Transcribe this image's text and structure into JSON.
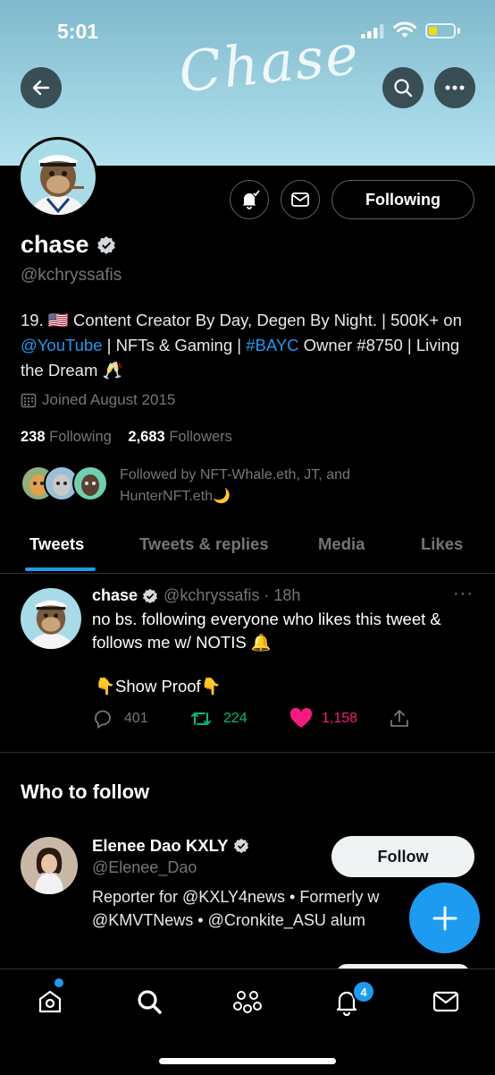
{
  "status": {
    "time": "5:01"
  },
  "banner": {
    "text": "Chase"
  },
  "profile": {
    "name": "chase",
    "handle": "@kchryssafis",
    "following_button": "Following",
    "bio": {
      "p1": "19. 🇺🇸 Content Creator By Day, Degen By Night. | 500K+ on ",
      "link1": "@YouTube",
      "p2": " | NFTs & Gaming | ",
      "link2": "#BAYC",
      "p3": " Owner #8750 | Living the Dream 🥂"
    },
    "joined": "Joined August 2015",
    "following_count": "238",
    "following_label": "Following",
    "followers_count": "2,683",
    "followers_label": "Followers",
    "followed_by": "Followed by NFT-Whale.eth, JT, and HunterNFT.eth🌙"
  },
  "tabs": [
    "Tweets",
    "Tweets & replies",
    "Media",
    "Likes"
  ],
  "tweet": {
    "name": "chase",
    "meta": "@kchryssafis · 18h",
    "text": "no bs. following everyone who likes this tweet & follows me w/ NOTIS 🔔",
    "link_card": "👇Show Proof👇",
    "replies": "401",
    "retweets": "224",
    "likes": "1,158",
    "colors": {
      "retweet": "#00ba7c",
      "like": "#f91880"
    }
  },
  "who_to_follow": {
    "title": "Who to follow",
    "items": [
      {
        "name": "Elenee Dao KXLY",
        "handle": "@Elenee_Dao",
        "bio_line1": "Reporter for @KXLY4news • Formerly w",
        "bio_line2": "@KMVTNews • @Cronkite_ASU alum",
        "button": "Follow"
      }
    ]
  },
  "nav": {
    "items": [
      "home-icon",
      "search-icon",
      "spaces-icon",
      "notifications-icon",
      "messages-icon"
    ],
    "notification_badge": "4"
  },
  "accent_color": "#1d9bf0"
}
